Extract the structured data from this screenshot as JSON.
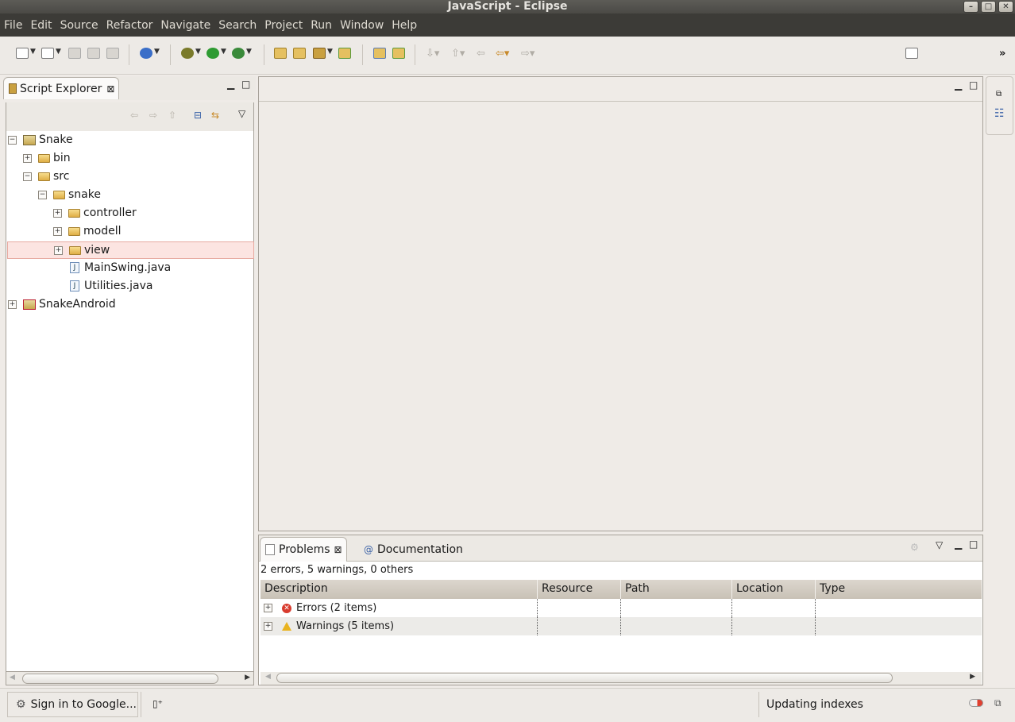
{
  "window": {
    "title": "JavaScript - Eclipse",
    "controls": [
      "minimize",
      "maximize",
      "close"
    ]
  },
  "menu": [
    "File",
    "Edit",
    "Source",
    "Refactor",
    "Navigate",
    "Search",
    "Project",
    "Run",
    "Window",
    "Help"
  ],
  "explorer": {
    "tab_label": "Script Explorer",
    "tree": [
      {
        "label": "Snake",
        "level": 0,
        "expander": "minus",
        "icon": "project-icon"
      },
      {
        "label": "bin",
        "level": 1,
        "expander": "plus",
        "icon": "folder-icon"
      },
      {
        "label": "src",
        "level": 1,
        "expander": "minus",
        "icon": "folder-icon"
      },
      {
        "label": "snake",
        "level": 2,
        "expander": "minus",
        "icon": "folder-icon"
      },
      {
        "label": "controller",
        "level": 3,
        "expander": "plus",
        "icon": "folder-icon"
      },
      {
        "label": "modell",
        "level": 3,
        "expander": "plus",
        "icon": "folder-icon"
      },
      {
        "label": "view",
        "level": 3,
        "expander": "plus",
        "icon": "folder-icon",
        "selected": true
      },
      {
        "label": "MainSwing.java",
        "level": 3,
        "expander": "none",
        "icon": "java-file-icon"
      },
      {
        "label": "Utilities.java",
        "level": 3,
        "expander": "none",
        "icon": "java-file-icon"
      },
      {
        "label": "SnakeAndroid",
        "level": 0,
        "expander": "plus",
        "icon": "project-error-icon"
      }
    ]
  },
  "problems": {
    "tabs": [
      "Problems",
      "Documentation"
    ],
    "summary": "2 errors, 5 warnings, 0 others",
    "columns": [
      "Description",
      "Resource",
      "Path",
      "Location",
      "Type"
    ],
    "rows": [
      {
        "label": "Errors (2 items)",
        "icon": "error-icon"
      },
      {
        "label": "Warnings (5 items)",
        "icon": "warning-icon"
      }
    ]
  },
  "status": {
    "sign_in": "Sign in to Google...",
    "message": "Updating indexes"
  }
}
